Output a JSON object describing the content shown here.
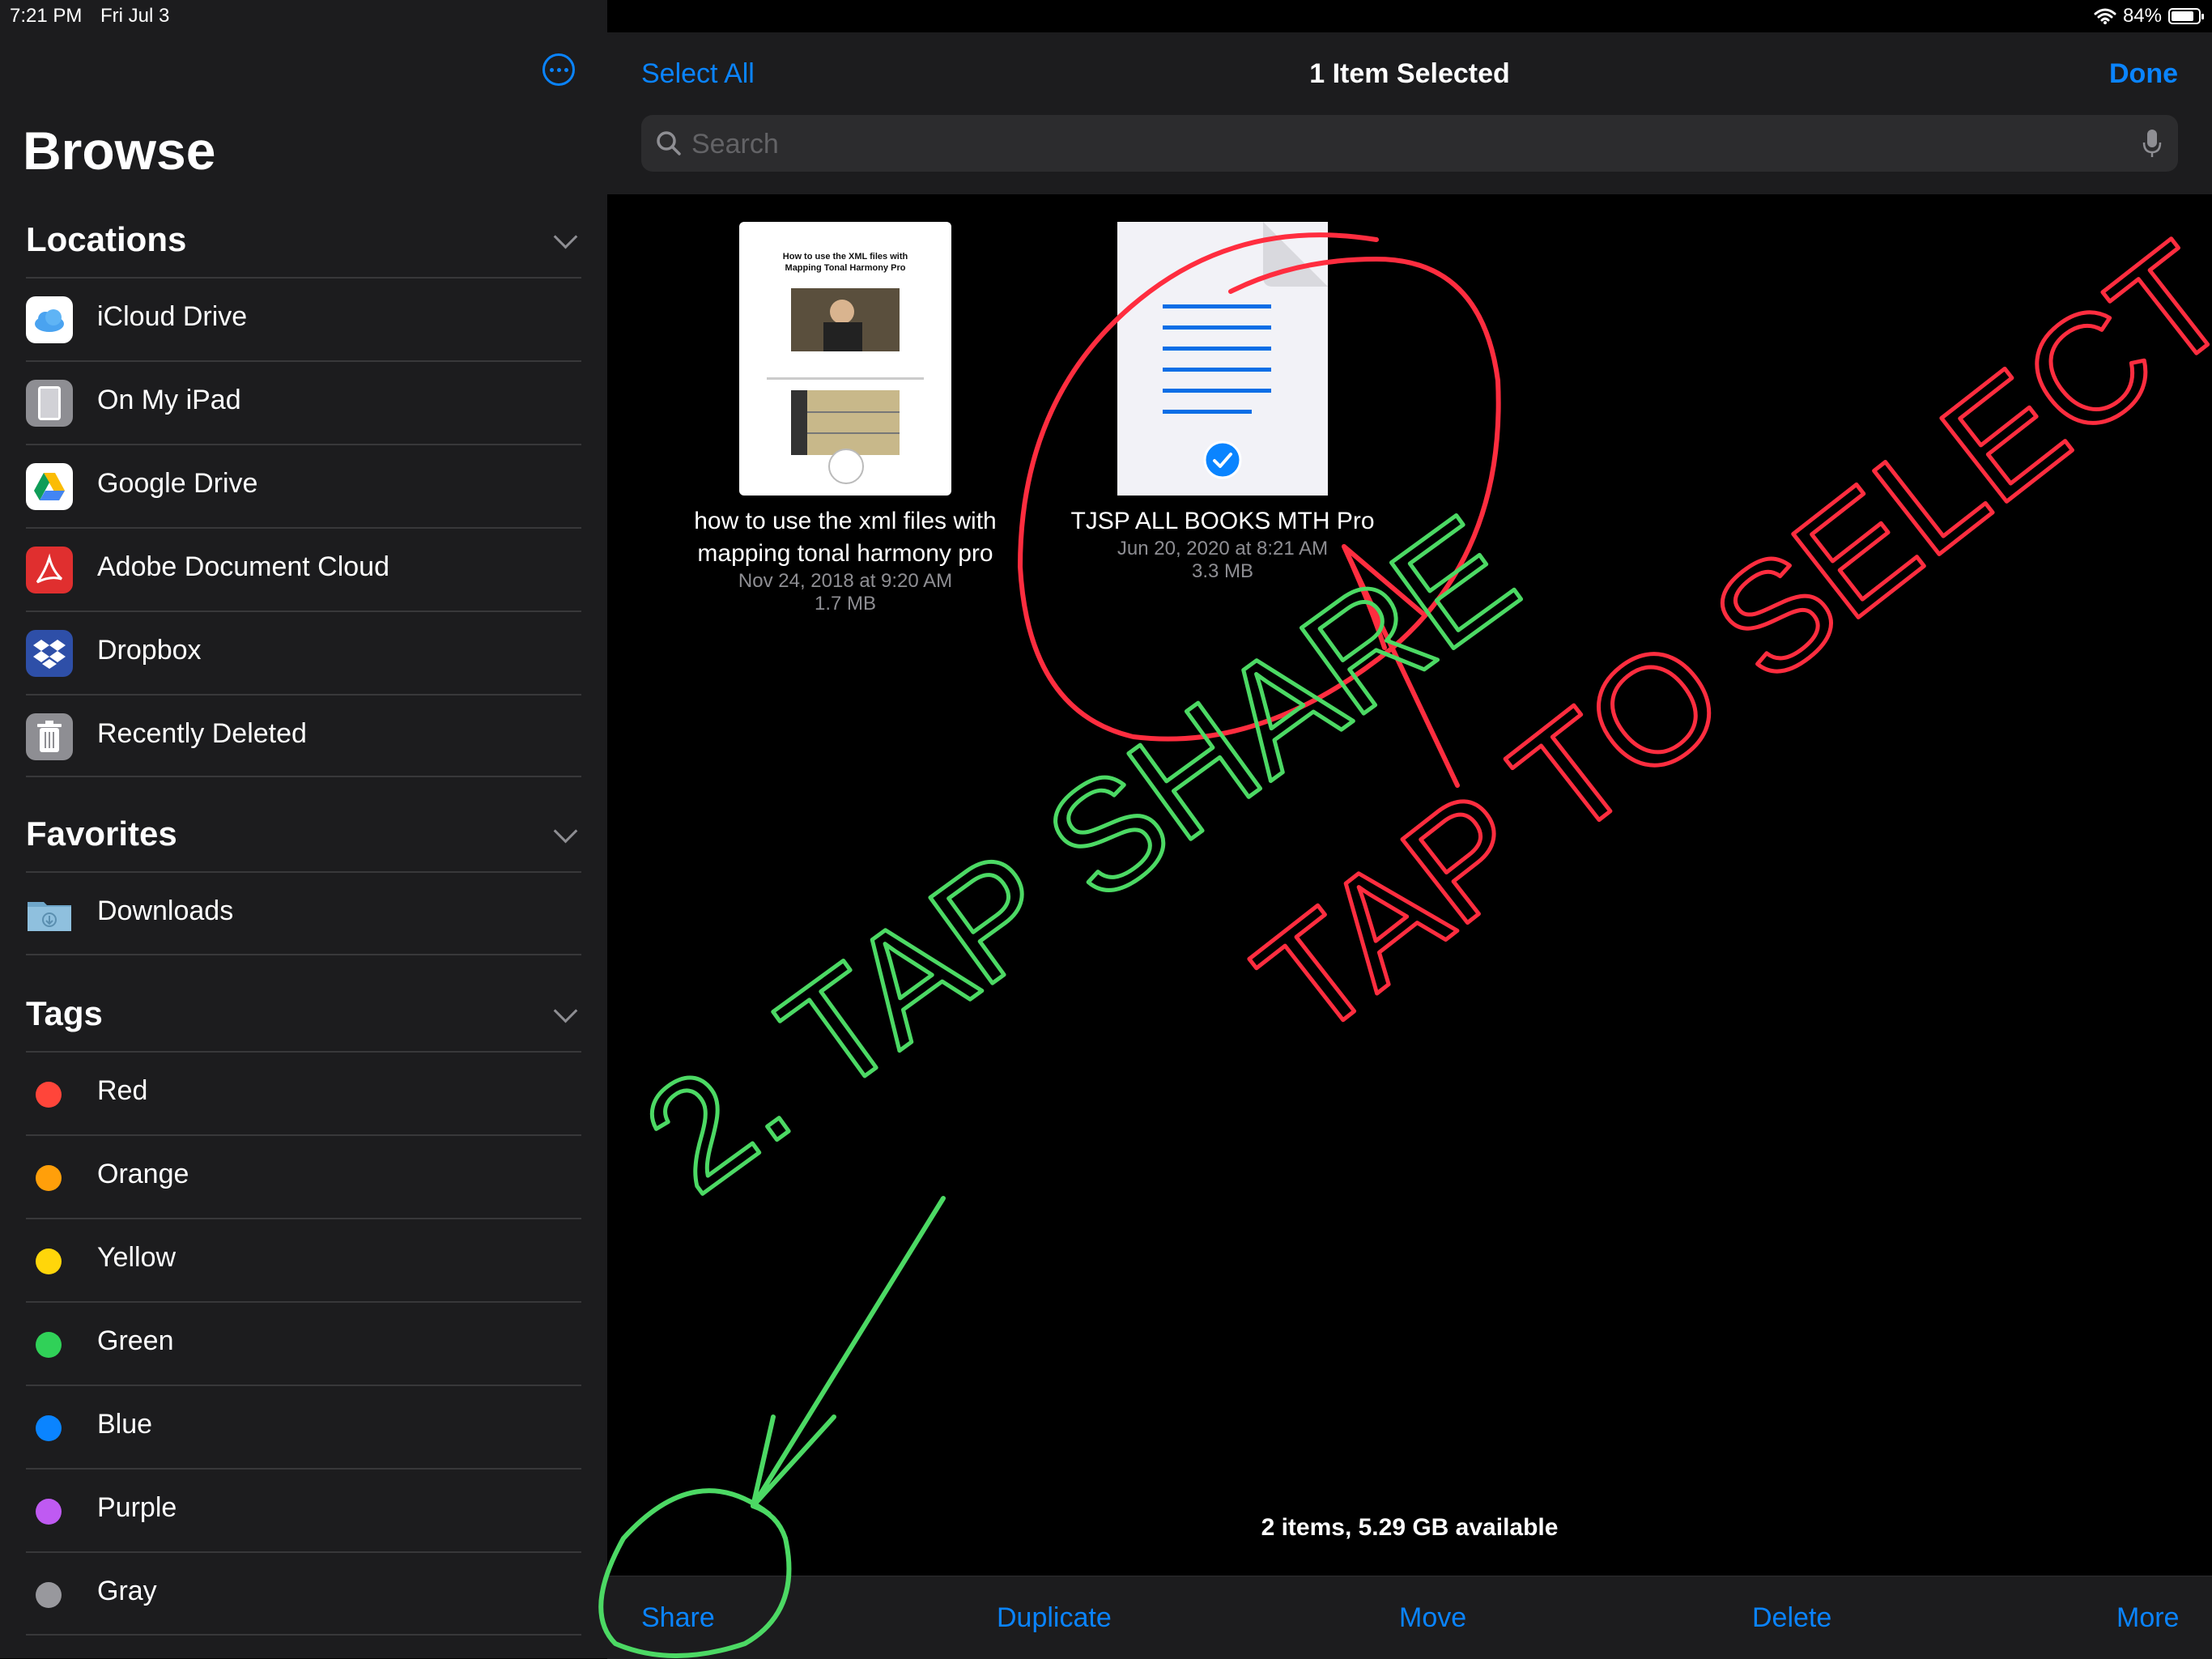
{
  "status": {
    "time": "7:21 PM",
    "date": "Fri Jul 3",
    "battery": "84%",
    "battery_level": 0.84
  },
  "sidebar": {
    "title": "Browse",
    "locations": {
      "header": "Locations",
      "items": [
        {
          "label": "iCloud Drive",
          "icon": "icloud-icon"
        },
        {
          "label": "On My iPad",
          "icon": "ipad-icon"
        },
        {
          "label": "Google Drive",
          "icon": "google-drive-icon"
        },
        {
          "label": "Adobe Document Cloud",
          "icon": "adobe-icon"
        },
        {
          "label": "Dropbox",
          "icon": "dropbox-icon"
        },
        {
          "label": "Recently Deleted",
          "icon": "trash-icon"
        }
      ]
    },
    "favorites": {
      "header": "Favorites",
      "items": [
        {
          "label": "Downloads",
          "icon": "downloads-folder-icon"
        }
      ]
    },
    "tags": {
      "header": "Tags",
      "items": [
        {
          "label": "Red",
          "color": "#ff453a"
        },
        {
          "label": "Orange",
          "color": "#ff9f0a"
        },
        {
          "label": "Yellow",
          "color": "#ffd60a"
        },
        {
          "label": "Green",
          "color": "#30d158"
        },
        {
          "label": "Blue",
          "color": "#0a84ff"
        },
        {
          "label": "Purple",
          "color": "#bf5af2"
        },
        {
          "label": "Gray",
          "color": "#98989d"
        }
      ]
    }
  },
  "header": {
    "select_all": "Select All",
    "title": "1 Item Selected",
    "done": "Done",
    "search_placeholder": "Search"
  },
  "files": [
    {
      "name_line1": "how to use the xml files with",
      "name_line2": "mapping tonal harmony pro",
      "date": "Nov 24, 2018 at 9:20 AM",
      "size": "1.7 MB",
      "selected": false,
      "thumb_title_line1": "How to use the XML files with",
      "thumb_title_line2": "Mapping Tonal Harmony Pro"
    },
    {
      "name_line1": "TJSP ALL BOOKS MTH Pro",
      "date": "Jun 20, 2020 at 8:21 AM",
      "size": "3.3 MB",
      "selected": true
    }
  ],
  "footer": {
    "info": "2 items, 5.29 GB available"
  },
  "toolbar": {
    "share": "Share",
    "duplicate": "Duplicate",
    "move": "Move",
    "delete": "Delete",
    "more": "More"
  },
  "annotations": {
    "red_text": "TAP TO SELECT",
    "green_text": "2. TAP SHARE",
    "red_color": "#ff2d3f",
    "green_color": "#4cd964"
  }
}
